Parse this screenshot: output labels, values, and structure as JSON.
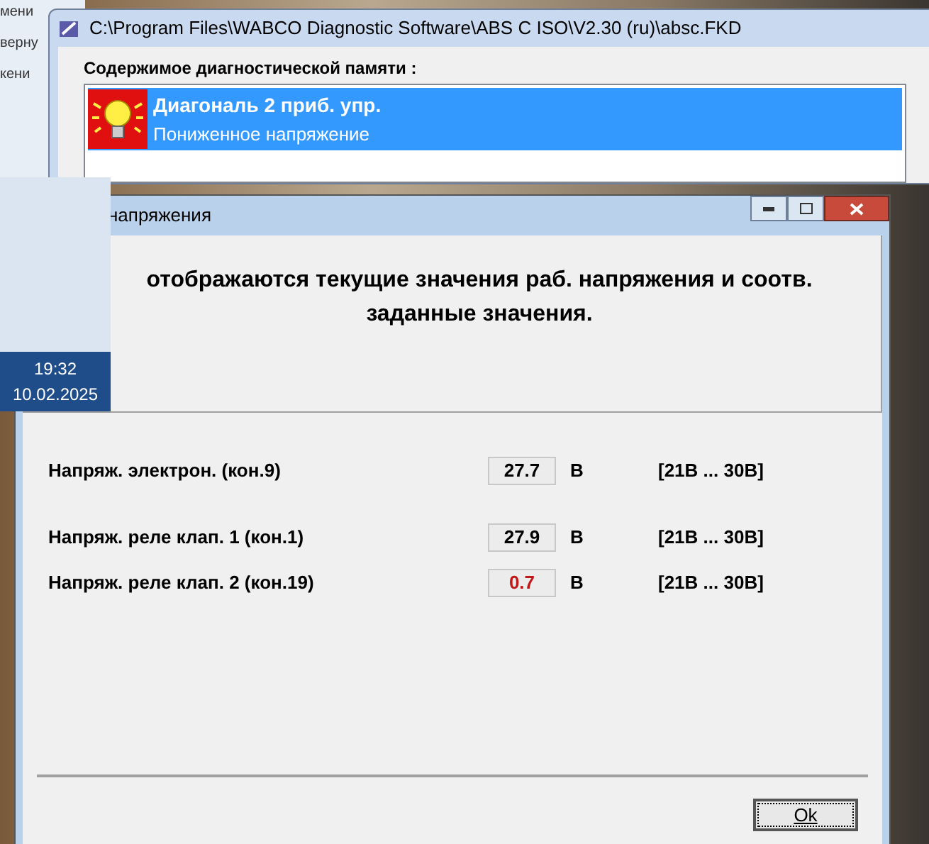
{
  "background_fragments": [
    "мени",
    "верну",
    "кени"
  ],
  "main_window": {
    "title": "C:\\Program Files\\WABCO Diagnostic Software\\ABS C ISO\\V2.30 (ru)\\absc.FKD",
    "memory_label": "Содержимое диагностической памяти :",
    "faults": [
      {
        "title": "Диагональ 2 приб. упр.",
        "description": "Пониженное напряжение",
        "selected": true
      }
    ]
  },
  "taskbar_clock": {
    "time": "19:32",
    "date": "10.02.2025"
  },
  "dialog": {
    "title": "напряжения",
    "heading": "отображаются текущие значения раб. напряжения и соотв. заданные значения.",
    "rows": [
      {
        "label": "Напряж. электрон. (кон.9)",
        "value": "27.7",
        "unit": "В",
        "range": "[21В ... 30В]",
        "out_of_range": false
      },
      {
        "label": "Напряж. реле клап. 1 (кон.1)",
        "value": "27.9",
        "unit": "В",
        "range": "[21В ... 30В]",
        "out_of_range": false
      },
      {
        "label": "Напряж. реле клап. 2 (кон.19)",
        "value": "0.7",
        "unit": "В",
        "range": "[21В ... 30В]",
        "out_of_range": true
      }
    ],
    "ok_button": "Ok"
  }
}
